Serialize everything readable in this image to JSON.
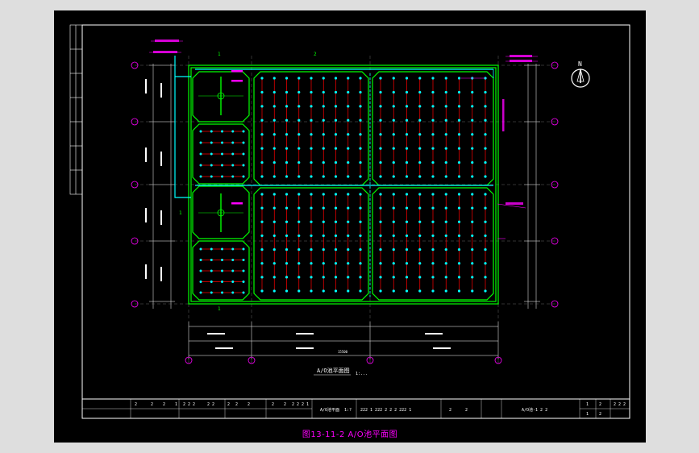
{
  "figure_caption": "图13-11-2  A/O池平面图",
  "plan_title": "A/O池平面图",
  "plan_scale": "1:...",
  "north_label": "N",
  "grid_bubbles": {
    "left": [
      "F",
      "E",
      "D",
      "C",
      "B",
      "A"
    ],
    "bottom": [
      "1",
      "2",
      "3",
      "4"
    ]
  },
  "section_marks": {
    "top_left": "1",
    "top_mid": "2"
  },
  "total_dimension": "15500",
  "title_block": {
    "cells": [
      "2",
      "2",
      "2",
      "1",
      "2 2 2",
      "2 2",
      "2",
      "2",
      "2",
      "2",
      "2",
      "2 2 2 1",
      "A/O池平面",
      "1:?",
      "222 1 222 2 2 2 222 1",
      "2",
      "2",
      "A/O池-1 2 2",
      "1",
      "2",
      "1",
      "2",
      "2 2 2"
    ]
  },
  "colors": {
    "sheet_bg": "#000000",
    "frame": "#ffffff",
    "wall": "#00ff00",
    "pipe": "#00ffff",
    "diffuser_line": "#ff0000",
    "annotation": "#ff00ff",
    "dimension": "#ffffff",
    "caption": "#ff00ff"
  }
}
